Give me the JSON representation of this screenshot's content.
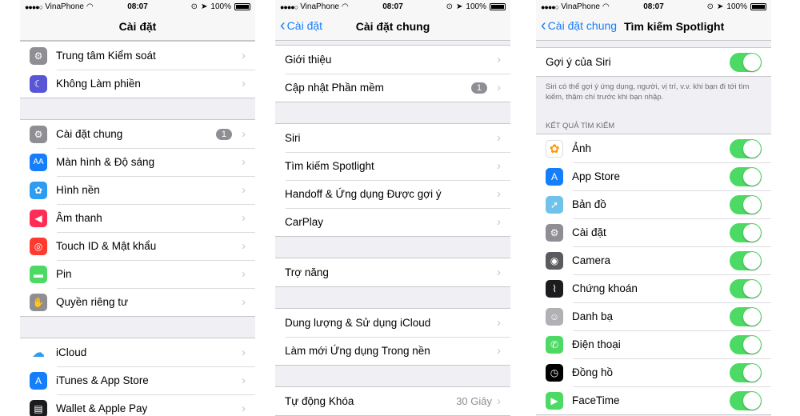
{
  "status": {
    "carrier": "VinaPhone",
    "time": "08:07",
    "battery": "100%"
  },
  "panel1": {
    "title": "Cài đặt",
    "group1": [
      {
        "label": "Trung tâm Kiểm soát",
        "icon": "control-center-icon",
        "color": "#8e8e93"
      },
      {
        "label": "Không Làm phiền",
        "icon": "moon-icon",
        "color": "#5856d6"
      }
    ],
    "group2": [
      {
        "label": "Cài đặt chung",
        "icon": "gear-icon",
        "color": "#8e8e93",
        "badge": "1"
      },
      {
        "label": "Màn hình & Độ sáng",
        "icon": "display-brightness-icon",
        "color": "#147efb"
      },
      {
        "label": "Hình nền",
        "icon": "wallpaper-icon",
        "color": "#2e9cf0"
      },
      {
        "label": "Âm thanh",
        "icon": "speaker-icon",
        "color": "#ff2d55"
      },
      {
        "label": "Touch ID & Mật khẩu",
        "icon": "fingerprint-icon",
        "color": "#ff3b30"
      },
      {
        "label": "Pin",
        "icon": "battery-icon",
        "color": "#4cd964"
      },
      {
        "label": "Quyền riêng tư",
        "icon": "hand-icon",
        "color": "#8e8e93"
      }
    ],
    "group3": [
      {
        "label": "iCloud",
        "icon": "icloud-icon",
        "color": "#ffffff"
      },
      {
        "label": "iTunes & App Store",
        "icon": "app-store-icon",
        "color": "#147efb"
      },
      {
        "label": "Wallet & Apple Pay",
        "icon": "wallet-icon",
        "color": "#1c1c1e"
      }
    ]
  },
  "panel2": {
    "back": "Cài đặt",
    "title": "Cài đặt chung",
    "group1": [
      "Giới thiệu",
      "Cập nhật Phần mềm"
    ],
    "update_badge": "1",
    "group2": [
      "Siri",
      "Tìm kiếm Spotlight",
      "Handoff & Ứng dụng Được gợi ý",
      "CarPlay"
    ],
    "group3": [
      "Trợ năng"
    ],
    "group4": [
      "Dung lượng & Sử dụng iCloud",
      "Làm mới Ứng dụng Trong nền"
    ],
    "group5_label": "Tự động Khóa",
    "group5_value": "30 Giây"
  },
  "panel3": {
    "back": "Cài đặt chung",
    "title": "Tìm kiếm Spotlight",
    "siri_label": "Gợi ý của Siri",
    "siri_desc": "Siri có thể gợi ý ứng dụng, người, vị trí, v.v. khi bạn đi tới tìm kiếm, thậm chí trước khi bạn nhập.",
    "section": "KẾT QUẢ TÌM KIẾM",
    "items": [
      {
        "label": "Ảnh",
        "icon": "photos-icon",
        "color": "#ff9500"
      },
      {
        "label": "App Store",
        "icon": "app-store-icon",
        "color": "#147efb"
      },
      {
        "label": "Bản đồ",
        "icon": "maps-icon",
        "color": "#6fc3ea"
      },
      {
        "label": "Cài đặt",
        "icon": "gear-icon",
        "color": "#8e8e93"
      },
      {
        "label": "Camera",
        "icon": "camera-icon",
        "color": "#5a5a5f"
      },
      {
        "label": "Chứng khoán",
        "icon": "stocks-icon",
        "color": "#1c1c1e"
      },
      {
        "label": "Danh bạ",
        "icon": "contacts-icon",
        "color": "#b0b0b5"
      },
      {
        "label": "Điện thoại",
        "icon": "phone-icon",
        "color": "#4cd964"
      },
      {
        "label": "Đồng hồ",
        "icon": "clock-icon",
        "color": "#000000"
      },
      {
        "label": "FaceTime",
        "icon": "facetime-icon",
        "color": "#4cd964"
      }
    ]
  }
}
